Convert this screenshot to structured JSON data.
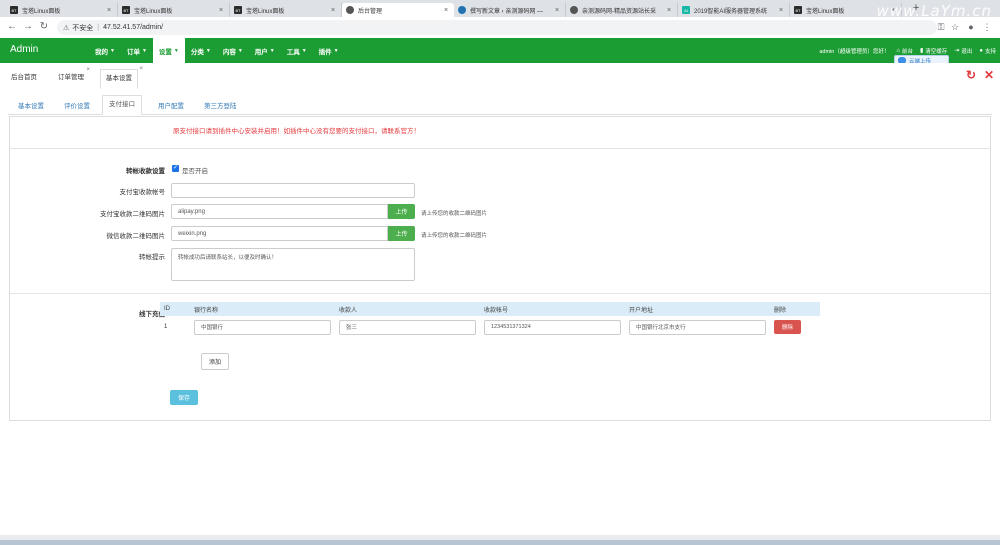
{
  "browser": {
    "tabs": [
      {
        "title": "宝塔Linux面板",
        "favicon": "BT"
      },
      {
        "title": "宝塔Linux面板",
        "favicon": "BT"
      },
      {
        "title": "宝塔Linux面板",
        "favicon": "BT"
      },
      {
        "title": "后台管理",
        "favicon": "globe"
      },
      {
        "title": "撰写新文章 ‹ 亲测源码网 —",
        "favicon": "wordpress"
      },
      {
        "title": "亲测源码网-精品资源站长采",
        "favicon": "globe"
      },
      {
        "title": "2019智能AI服务器管理系统",
        "favicon": "AI"
      },
      {
        "title": "宝塔Linux面板",
        "favicon": "BT"
      }
    ],
    "watermark": "www.LaYm.cn",
    "url_warning": "不安全",
    "url": "47.52.41.57/admin/"
  },
  "navbar": {
    "brand": "Admin",
    "menu": [
      {
        "label": "我的",
        "active": false
      },
      {
        "label": "订单",
        "active": false
      },
      {
        "label": "设置",
        "active": true
      },
      {
        "label": "分类",
        "active": false
      },
      {
        "label": "内容",
        "active": false
      },
      {
        "label": "用户",
        "active": false
      },
      {
        "label": "工具",
        "active": false
      },
      {
        "label": "插件",
        "active": false
      }
    ],
    "user_greeting": "admin（超级管理员）您好！",
    "home": "前台",
    "clear_cache": "清空缓存",
    "logout": "退出",
    "support": "支持",
    "cloud_tip": "云端上传",
    "accent": "#1c9d34"
  },
  "page_tabs": [
    {
      "label": "后台首页"
    },
    {
      "label": "订单管理"
    },
    {
      "label": "基本设置"
    }
  ],
  "sub_tabs": [
    {
      "label": "基本设置"
    },
    {
      "label": "评价设置"
    },
    {
      "label": "支付接口"
    },
    {
      "label": "用户配置"
    },
    {
      "label": "第三方登陆"
    }
  ],
  "form": {
    "notice": "原支付接口请到插件中心安装并启用！如插件中心没有您要的支付接口，请联系官方！",
    "transfer_setting_label": "转帐收款设置",
    "enable_label": "是否开启",
    "alipay_account_label": "支付宝收款帐号",
    "alipay_account_value": "",
    "alipay_qr_label": "支付宝收款二维码图片",
    "alipay_qr_value": "alipay.png",
    "wechat_qr_label": "微信收款二维码图片",
    "wechat_qr_value": "weixin.png",
    "upload_label": "上传",
    "upload_help": "请上传您的收款二维码图片",
    "transfer_tip_label": "转帐提示",
    "transfer_tip_value": "转帐成功后请联系站长，以便及时确认！",
    "offline_label": "线下充值",
    "table_headers": [
      "ID",
      "银行名称",
      "收款人",
      "收款帐号",
      "开户地址",
      "删除"
    ],
    "rows": [
      {
        "id": "1",
        "bank": "中国银行",
        "payee": "张三",
        "account": "1234531371324",
        "address": "中国银行北京市支行",
        "delete": "删除"
      }
    ],
    "add_label": "添加",
    "save_label": "保存"
  }
}
